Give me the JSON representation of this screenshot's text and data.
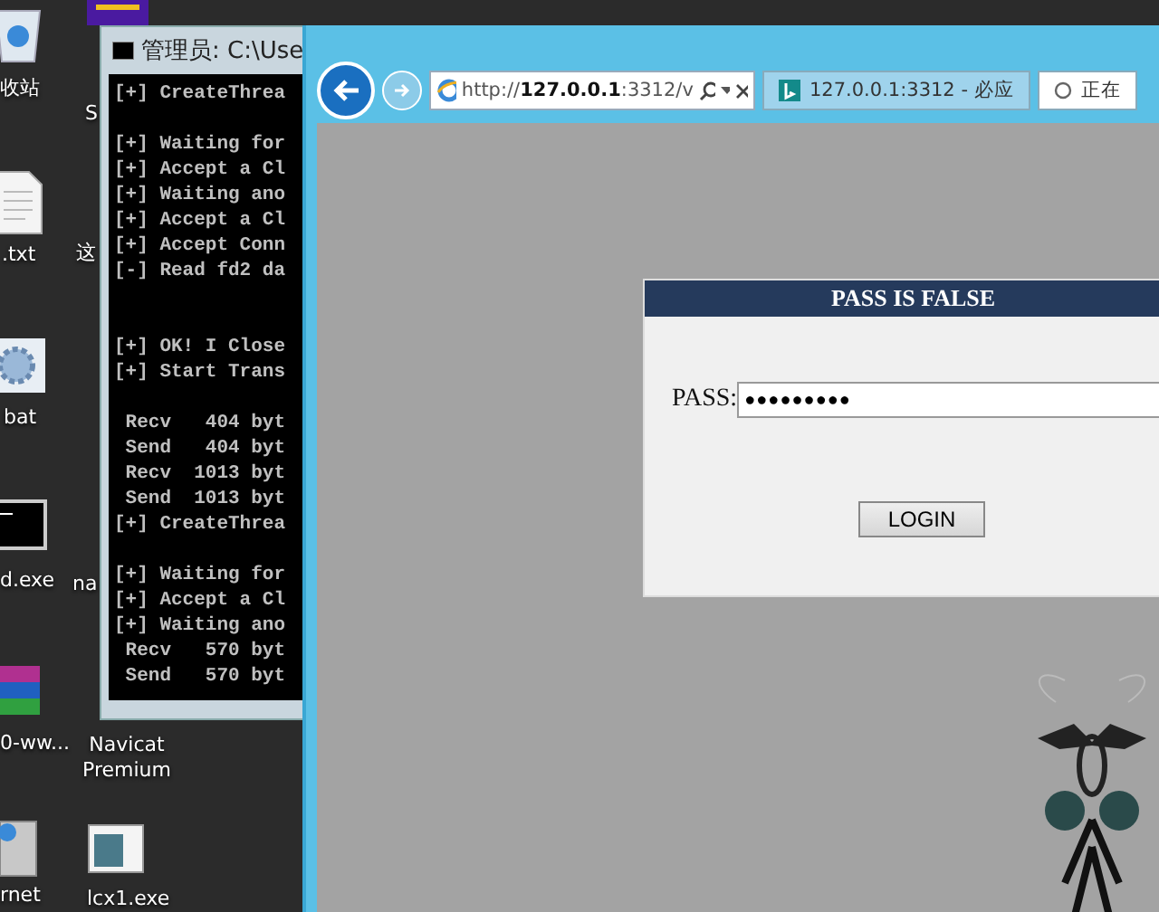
{
  "desktop_icons": [
    {
      "label": "收站",
      "kind": "bin"
    },
    {
      "label": ".txt",
      "kind": "file"
    },
    {
      "label": "bat",
      "kind": "gear"
    },
    {
      "label": "d.exe",
      "kind": "console"
    },
    {
      "label": "0-ww...",
      "kind": "archive"
    },
    {
      "label": "rnet",
      "kind": "server"
    },
    {
      "label": "S",
      "kind": "app"
    },
    {
      "label": "这",
      "kind": "none"
    },
    {
      "label": "na",
      "kind": "none"
    },
    {
      "label": "Navicat Premium",
      "kind": "none"
    },
    {
      "label": "lcx1.exe",
      "kind": "window"
    }
  ],
  "console": {
    "title": "管理员: C:\\Use",
    "lines": [
      {
        "kind": "text",
        "text": "[+] CreateThrea"
      },
      {
        "kind": "blank"
      },
      {
        "kind": "text",
        "text": "[+] Waiting for"
      },
      {
        "kind": "text",
        "text": "[+] Accept a Cl"
      },
      {
        "kind": "text",
        "text": "[+] Waiting ano"
      },
      {
        "kind": "text",
        "text": "[+] Accept a Cl"
      },
      {
        "kind": "text",
        "text": "[+] Accept Conn"
      },
      {
        "kind": "text",
        "text": "[-] Read fd2 da"
      },
      {
        "kind": "blank"
      },
      {
        "kind": "blank"
      },
      {
        "kind": "text",
        "text": "[+] OK! I Close"
      },
      {
        "kind": "text",
        "text": "[+] Start Trans"
      },
      {
        "kind": "blank"
      },
      {
        "kind": "text",
        "text": " Recv   404 byt"
      },
      {
        "kind": "text",
        "text": " Send   404 byt"
      },
      {
        "kind": "text",
        "text": " Recv  1013 byt"
      },
      {
        "kind": "text",
        "text": " Send  1013 byt"
      },
      {
        "kind": "text",
        "text": "[+] CreateThrea"
      },
      {
        "kind": "blank"
      },
      {
        "kind": "text",
        "text": "[+] Waiting for"
      },
      {
        "kind": "text",
        "text": "[+] Accept a Cl"
      },
      {
        "kind": "text",
        "text": "[+] Waiting ano"
      },
      {
        "kind": "text",
        "text": " Recv   570 byt"
      },
      {
        "kind": "text",
        "text": " Send   570 byt"
      }
    ]
  },
  "browser": {
    "address": "http://**127.0.0.1**:3312/v",
    "tabs": [
      {
        "label": "127.0.0.1:3312 - 必应",
        "selected": false,
        "kind": "site"
      },
      {
        "label": "正在",
        "selected": true,
        "kind": "loading"
      }
    ],
    "login": {
      "header": "PASS IS FALSE",
      "label": "PASS:",
      "value": "●●●●●●●●●",
      "button": "LOGIN"
    }
  }
}
